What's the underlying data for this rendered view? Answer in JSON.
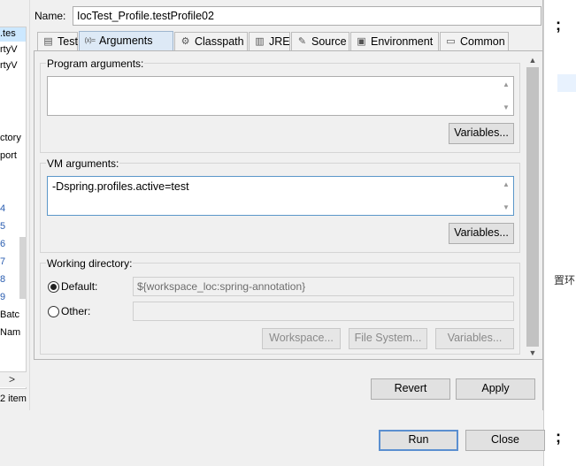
{
  "left_tree": {
    "rows": [
      {
        "text": ".tes",
        "selected": true,
        "blue": false
      },
      {
        "text": "rtyV",
        "selected": false,
        "blue": false
      },
      {
        "text": "rtyV",
        "selected": false,
        "blue": false
      },
      {
        "text": "ctory",
        "selected": false,
        "blue": false
      },
      {
        "text": "port",
        "selected": false,
        "blue": false
      },
      {
        "text": "4",
        "selected": false,
        "blue": true
      },
      {
        "text": "5",
        "selected": false,
        "blue": true
      },
      {
        "text": "6",
        "selected": false,
        "blue": true
      },
      {
        "text": "7",
        "selected": false,
        "blue": true
      },
      {
        "text": "8",
        "selected": false,
        "blue": true
      },
      {
        "text": "9",
        "selected": false,
        "blue": true
      },
      {
        "text": "Batc",
        "selected": false,
        "blue": false
      },
      {
        "text": "Nam",
        "selected": false,
        "blue": false
      }
    ],
    "scroll_arrow": ">",
    "status": "2 item"
  },
  "right_editor": {
    "semicolon_top": ";",
    "cn_text": "置环",
    "semicolon_bottom": ";"
  },
  "dialog": {
    "name_label": "Name:",
    "name_value": "IocTest_Profile.testProfile02",
    "tabs": [
      {
        "label": "Test",
        "icon": "test-icon",
        "glyph": "▤",
        "active": false
      },
      {
        "label": "Arguments",
        "icon": "arguments-icon",
        "glyph": "(x)=",
        "active": true
      },
      {
        "label": "Classpath",
        "icon": "classpath-icon",
        "glyph": "⚙",
        "active": false
      },
      {
        "label": "JRE",
        "icon": "jre-icon",
        "glyph": "▥",
        "active": false
      },
      {
        "label": "Source",
        "icon": "source-icon",
        "glyph": "✎",
        "active": false
      },
      {
        "label": "Environment",
        "icon": "environment-icon",
        "glyph": "▣",
        "active": false
      },
      {
        "label": "Common",
        "icon": "common-icon",
        "glyph": "▭",
        "active": false
      }
    ],
    "program_args": {
      "label": "Program arguments:",
      "value": "",
      "variables_button": "Variables..."
    },
    "vm_args": {
      "label": "VM arguments:",
      "value": "-Dspring.profiles.active=test",
      "variables_button": "Variables..."
    },
    "working_dir": {
      "label": "Working directory:",
      "default_label": "Default:",
      "default_value": "${workspace_loc:spring-annotation}",
      "default_selected": true,
      "other_label": "Other:",
      "other_value": "",
      "workspace_button": "Workspace...",
      "filesystem_button": "File System...",
      "variables_button": "Variables..."
    },
    "revert_button": "Revert",
    "apply_button": "Apply",
    "run_button": "Run",
    "close_button": "Close"
  },
  "colors": {
    "active_tab": "#dde9f6",
    "focus_border": "#5b97c9",
    "default_button_border": "#5b8fd0"
  }
}
